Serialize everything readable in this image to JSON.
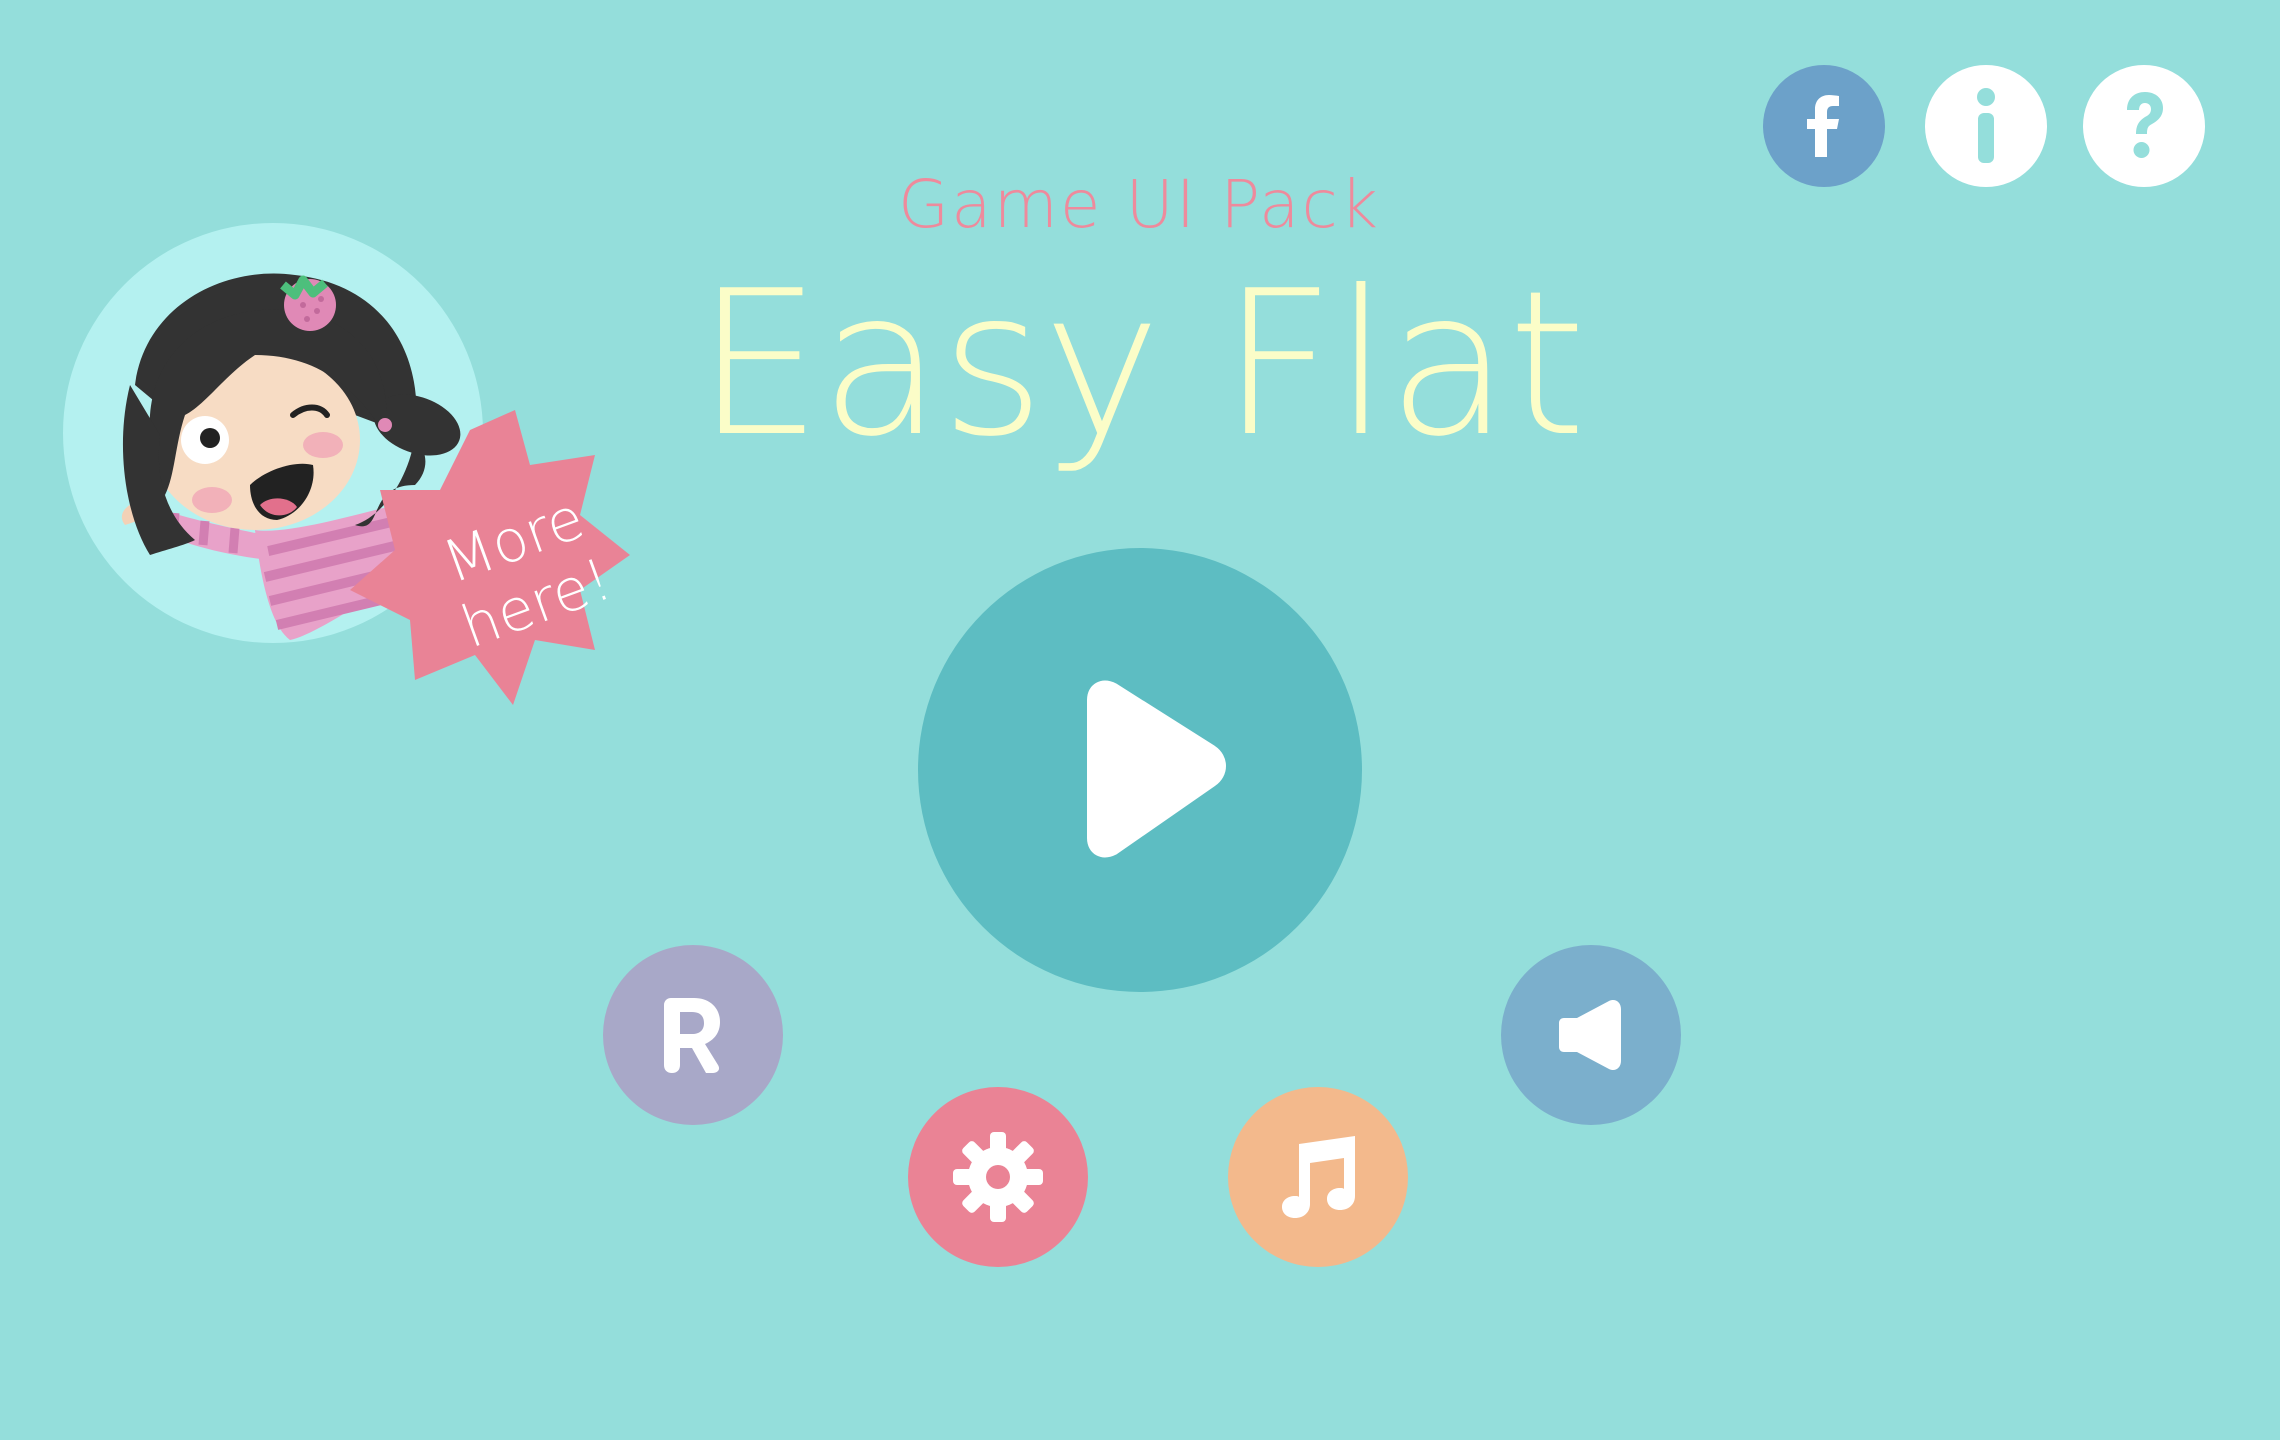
{
  "header": {
    "subtitle": "Game UI Pack",
    "title": "Easy Flat"
  },
  "promo": {
    "label_line1": "More",
    "label_line2": "here!"
  },
  "top_buttons": [
    {
      "icon": "facebook-icon",
      "color": "#6ca1c9"
    },
    {
      "icon": "info-icon",
      "color": "#ffffff"
    },
    {
      "icon": "help-icon",
      "color": "#ffffff"
    }
  ],
  "main_buttons": {
    "play": {
      "icon": "play-icon",
      "color": "#5dbdc2"
    },
    "rate": {
      "icon": "rate-icon",
      "glyph": "R",
      "color": "#a8a8c8"
    },
    "settings": {
      "icon": "gear-icon",
      "color": "#ea8395"
    },
    "music": {
      "icon": "music-note-icon",
      "color": "#f3b98c"
    },
    "sound": {
      "icon": "speaker-icon",
      "color": "#7bafcc"
    }
  },
  "colors": {
    "background": "#94dedb",
    "accent_pink": "#ee8a9c",
    "title_yellow": "#fbfdc8"
  }
}
